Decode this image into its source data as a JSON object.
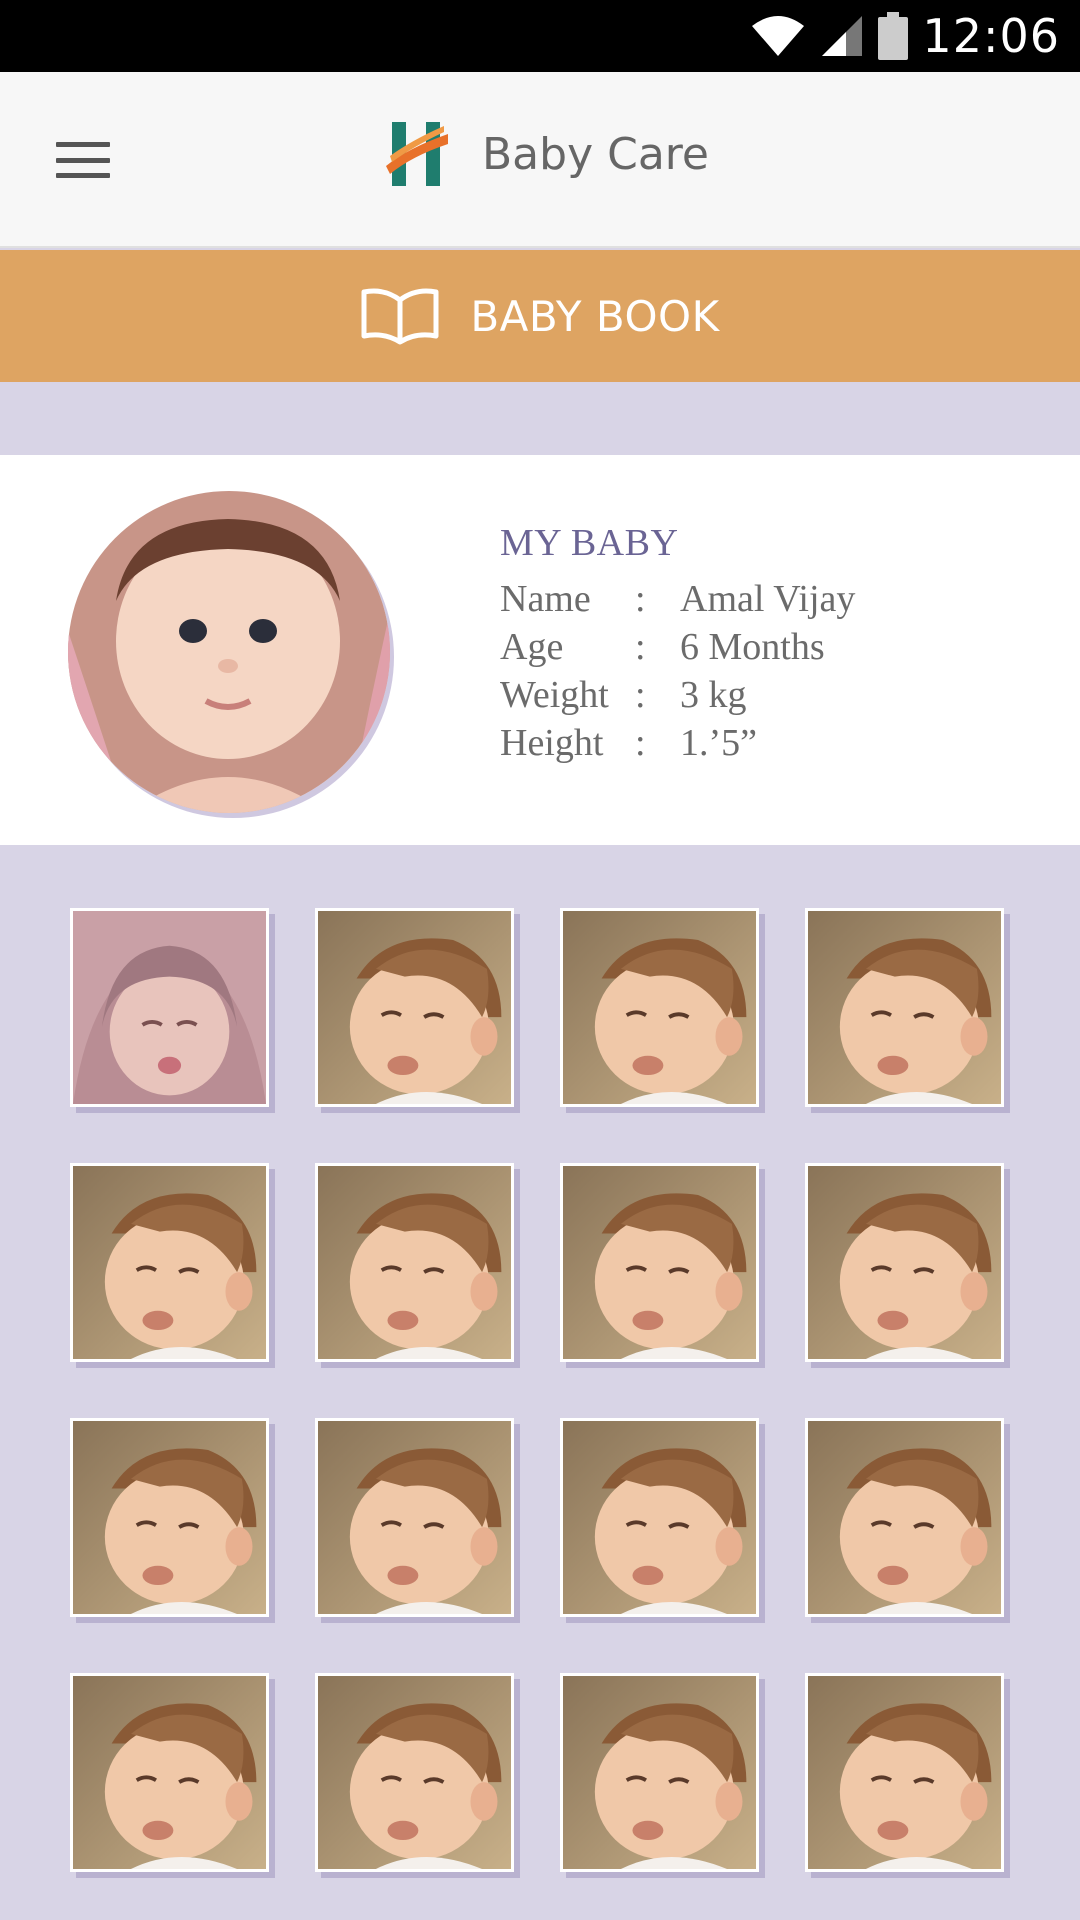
{
  "status_bar": {
    "time": "12:06",
    "icons": [
      "wifi-icon",
      "signal-icon",
      "battery-icon"
    ]
  },
  "app_bar": {
    "title": "Baby Care",
    "menu_icon": "hamburger-menu-icon",
    "logo_icon": "hospital-h-logo-icon"
  },
  "section_bar": {
    "label": "BABY BOOK",
    "icon": "open-book-icon"
  },
  "profile": {
    "title": "MY BABY",
    "fields": [
      {
        "label": "Name",
        "sep": ":",
        "value": "Amal Vijay"
      },
      {
        "label": "Age",
        "sep": ":",
        "value": "6 Months"
      },
      {
        "label": "Weight",
        "sep": ":",
        "value": "3 kg"
      },
      {
        "label": "Height",
        "sep": ":",
        "value": "1.’5”"
      }
    ]
  },
  "gallery": {
    "photos": [
      {
        "kind": "sleeping-baby-photo"
      },
      {
        "kind": "pouting-baby-photo"
      },
      {
        "kind": "pouting-baby-photo"
      },
      {
        "kind": "pouting-baby-photo"
      },
      {
        "kind": "pouting-baby-photo"
      },
      {
        "kind": "pouting-baby-photo"
      },
      {
        "kind": "pouting-baby-photo"
      },
      {
        "kind": "pouting-baby-photo"
      },
      {
        "kind": "pouting-baby-photo"
      },
      {
        "kind": "pouting-baby-photo"
      },
      {
        "kind": "pouting-baby-photo"
      },
      {
        "kind": "pouting-baby-photo"
      },
      {
        "kind": "pouting-baby-photo"
      },
      {
        "kind": "pouting-baby-photo"
      },
      {
        "kind": "pouting-baby-photo"
      },
      {
        "kind": "pouting-baby-photo"
      }
    ]
  },
  "colors": {
    "accent_orange": "#dea462",
    "background_lavender": "#d8d4e6",
    "title_purple": "#6a6494",
    "logo_teal": "#1f7d6e",
    "logo_orange": "#e8712a"
  }
}
